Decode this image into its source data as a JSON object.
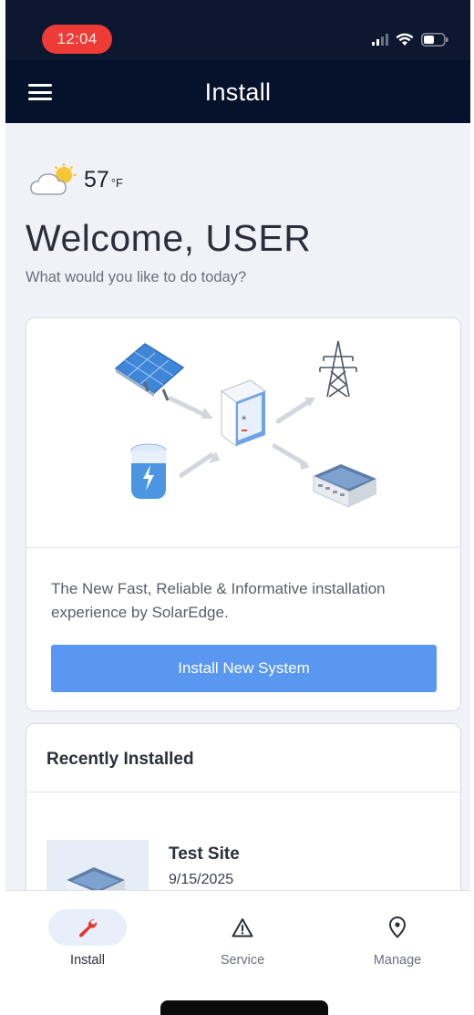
{
  "status_bar": {
    "time": "12:04",
    "icons": [
      "cellular-signal-icon",
      "wifi-icon",
      "battery-icon"
    ],
    "time_pill_color": "#ee3b36"
  },
  "app_bar": {
    "title": "Install",
    "menu_icon": "hamburger-menu-icon",
    "background": "#06112b"
  },
  "weather": {
    "icon": "partly-cloudy-icon",
    "temperature": "57",
    "unit": "°F"
  },
  "welcome": {
    "heading": "Welcome, USER",
    "subtitle": "What would you like to do today?"
  },
  "install_card": {
    "illustration": [
      "solar-panel-icon",
      "inverter-icon",
      "power-tower-icon",
      "battery-storage-icon",
      "house-icon"
    ],
    "description": "The New Fast, Reliable & Informative installation experience by SolarEdge.",
    "button_label": "Install New System",
    "button_color": "#5a97f0"
  },
  "recent": {
    "title": "Recently Installed",
    "items": [
      {
        "name": "Test Site",
        "date": "9/15/2025",
        "thumbnail": "site-house-thumbnail"
      }
    ]
  },
  "bottom_nav": {
    "items": [
      {
        "label": "Install",
        "icon": "wrench-icon",
        "active": true
      },
      {
        "label": "Service",
        "icon": "warning-triangle-icon",
        "active": false
      },
      {
        "label": "Manage",
        "icon": "location-pin-icon",
        "active": false
      }
    ],
    "accent_color": "#e5352b"
  }
}
